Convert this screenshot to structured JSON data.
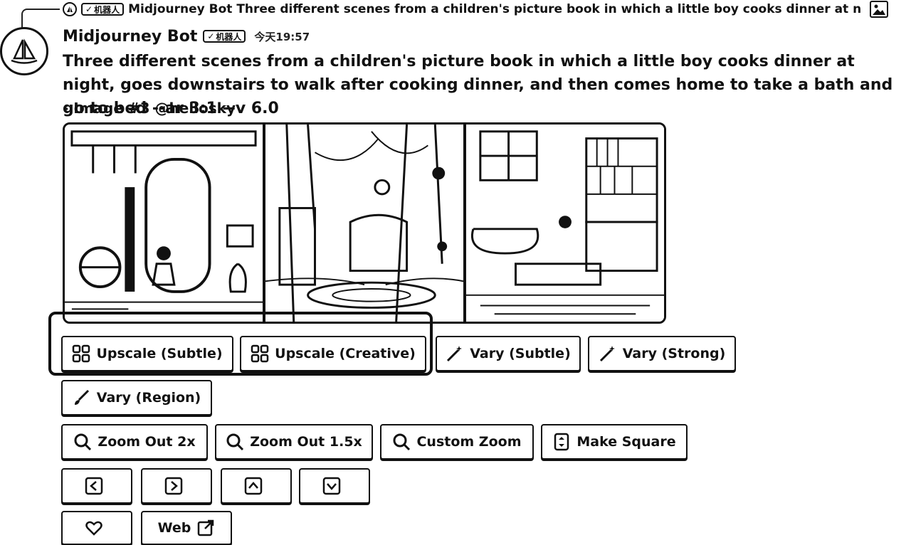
{
  "reply": {
    "author": "Midjourney Bot",
    "badge": "机器人",
    "preview": "Three different scenes from a children's picture book in which a little boy cooks dinner at n",
    "icon": "image-icon"
  },
  "message": {
    "author": "Midjourney Bot",
    "badge": "机器人",
    "timestamp": "今天19:57",
    "prompt": "Three different scenes from a children's picture book in which a little boy cooks dinner at night, goes downstairs to walk after cooking dinner, and then comes home to take a bath and go to bed --ar 3:1 --v 6.0",
    "suffix": "- Image #3 @hellosky"
  },
  "image": {
    "panels": [
      "kitchen-scene",
      "forest-walk-scene",
      "bedroom-bath-scene"
    ]
  },
  "buttons": {
    "upscale_subtle": "Upscale (Subtle)",
    "upscale_creative": "Upscale (Creative)",
    "vary_subtle": "Vary (Subtle)",
    "vary_strong": "Vary (Strong)",
    "vary_region": "Vary (Region)",
    "zoom_out_2x": "Zoom Out 2x",
    "zoom_out_1_5x": "Zoom Out 1.5x",
    "custom_zoom": "Custom Zoom",
    "make_square": "Make Square",
    "pan_left": "",
    "pan_right": "",
    "pan_up": "",
    "pan_down": "",
    "favorite": "",
    "web": "Web"
  },
  "colors": {
    "ink": "#111111",
    "background": "#ffffff"
  }
}
